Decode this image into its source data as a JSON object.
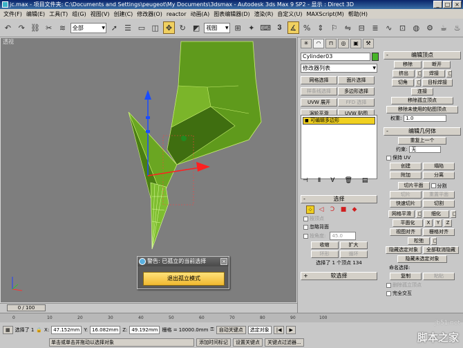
{
  "title_bar": {
    "text": "jc.max  - 项目文件夹: C:\\Documents and Settings\\peugeot\\My Documents\\3dsmax  - Autodesk 3ds Max 9 SP2  - 显示 : Direct 3D",
    "buttons": [
      "_",
      "□",
      "×"
    ]
  },
  "menu": [
    "文件(F)",
    "编辑(E)",
    "工具(T)",
    "组(G)",
    "视图(V)",
    "创建(C)",
    "修改器(O)",
    "reactor",
    "动画(A)",
    "图表编辑器(D)",
    "渲染(R)",
    "自定义(U)",
    "MAXScript(M)",
    "帮助(H)"
  ],
  "toolbar": {
    "select_filter": "全部",
    "ref_coord": "视图",
    "icons": [
      "undo-icon",
      "redo-icon",
      "link-icon",
      "unlink-icon",
      "bind-icon",
      "select-icon",
      "select-by-name-icon",
      "rect-select-icon",
      "window-crossing-icon",
      "move-icon",
      "rotate-icon",
      "scale-icon",
      "pivot-icon",
      "manipulate-icon",
      "keyboard-icon",
      "snap-icon",
      "angle-snap-icon",
      "percent-snap-icon",
      "spinner-snap-icon",
      "named-set-icon",
      "mirror-icon",
      "align-icon",
      "layer-icon",
      "curve-editor-icon",
      "schematic-icon",
      "material-icon",
      "render-setup-icon",
      "render-icon",
      "quick-render-icon"
    ]
  },
  "viewport": {
    "label": "透视",
    "dialog": {
      "title": "警告: 已孤立的当前选择",
      "close": "×",
      "button": "退出孤立模式"
    }
  },
  "time": {
    "slider": "0 / 100",
    "ticks": [
      "0",
      "10",
      "20",
      "30",
      "40",
      "50",
      "60",
      "70",
      "80",
      "90",
      "100"
    ]
  },
  "status": {
    "selected": "选择了 1",
    "lock": "🔒",
    "x_label": "X:",
    "x": "47.152mm",
    "y_label": "Y:",
    "y": "16.082mm",
    "z_label": "Z:",
    "z": "49.192mm",
    "grid": "栅格 = 10000.0mm",
    "auto_key": "自动关键点",
    "auto_key_mode": "选定对象",
    "prompt": "单击或单击并拖动以选择对象",
    "add_time_tag": "添加时间标记",
    "set_key": "设置关键点",
    "key_filter": "关键点过滤器..."
  },
  "command_panel": {
    "tabs": [
      "创建",
      "修改",
      "层次",
      "运动",
      "显示",
      "工具"
    ],
    "object_name": "Cylinder03",
    "object_color": "#46b428",
    "modifier_list": "修改器列表",
    "modifier_buttons": [
      {
        "label": "网格选择",
        "disabled": false
      },
      {
        "label": "面片选择",
        "disabled": false
      },
      {
        "label": "样条线选择",
        "disabled": true
      },
      {
        "label": "多边形选择",
        "disabled": false
      },
      {
        "label": "UVW 展开",
        "disabled": false
      },
      {
        "label": "FFD 选择",
        "disabled": true
      },
      {
        "label": "涡轮平滑",
        "disabled": false
      },
      {
        "label": "UVW 贴图",
        "disabled": false
      }
    ],
    "stack_item": "可编辑多边形",
    "stack_icons": [
      "pin-stack-icon",
      "show-end-result-icon",
      "make-unique-icon",
      "remove-modifier-icon",
      "configure-icon"
    ],
    "selection": {
      "header": "选择",
      "by_vertex": "按顶点",
      "ignore_backfacing": "忽略背面",
      "by_angle": "按角度:",
      "angle_value": "45.0",
      "shrink": "收缩",
      "grow": "扩大",
      "ring": "环形",
      "loop": "循环",
      "status": "选择了 1 个顶点 134"
    },
    "soft_selection": "软选择",
    "edit_vertices": {
      "header": "编辑顶点",
      "remove": "移除",
      "break": "断开",
      "extrude": "挤出",
      "weld": "焊接",
      "chamfer": "切角",
      "target_weld": "目标焊接",
      "connect": "连接",
      "remove_isolated": "移除孤立顶点",
      "remove_unused_map": "移除未使用的贴图顶点",
      "weight_label": "权重:",
      "weight": "1.0"
    },
    "edit_geometry": {
      "header": "编辑几何体",
      "repeat_last": "重复上一个",
      "constraints_label": "约束:",
      "constraints_value": "无",
      "preserve_uvs": "保持 UV",
      "create": "创建",
      "collapse": "塌陷",
      "attach": "附加",
      "detach": "分离",
      "slice_plane": "切片平面",
      "split": "分割",
      "slice": "切片",
      "reset_plane": "重置平面",
      "quickslice": "快速切片",
      "cut": "切割",
      "msmooth": "网格平滑",
      "tessellate": "细化",
      "make_planar": "平面化",
      "x": "X",
      "y": "Y",
      "z": "Z",
      "view_align": "视图对齐",
      "grid_align": "栅格对齐",
      "relax": "松弛",
      "hide_selected": "隐藏选定对象",
      "unhide_all": "全部取消隐藏",
      "hide_unselected": "隐藏未选定对象",
      "named_sel_label": "命名选择:",
      "copy": "复制",
      "paste": "粘贴",
      "delete_isolated": "删除孤立顶点",
      "full_interactivity": "完全交互"
    }
  },
  "watermark": {
    "line1": "jb51.net",
    "line2": "脚本之家"
  }
}
